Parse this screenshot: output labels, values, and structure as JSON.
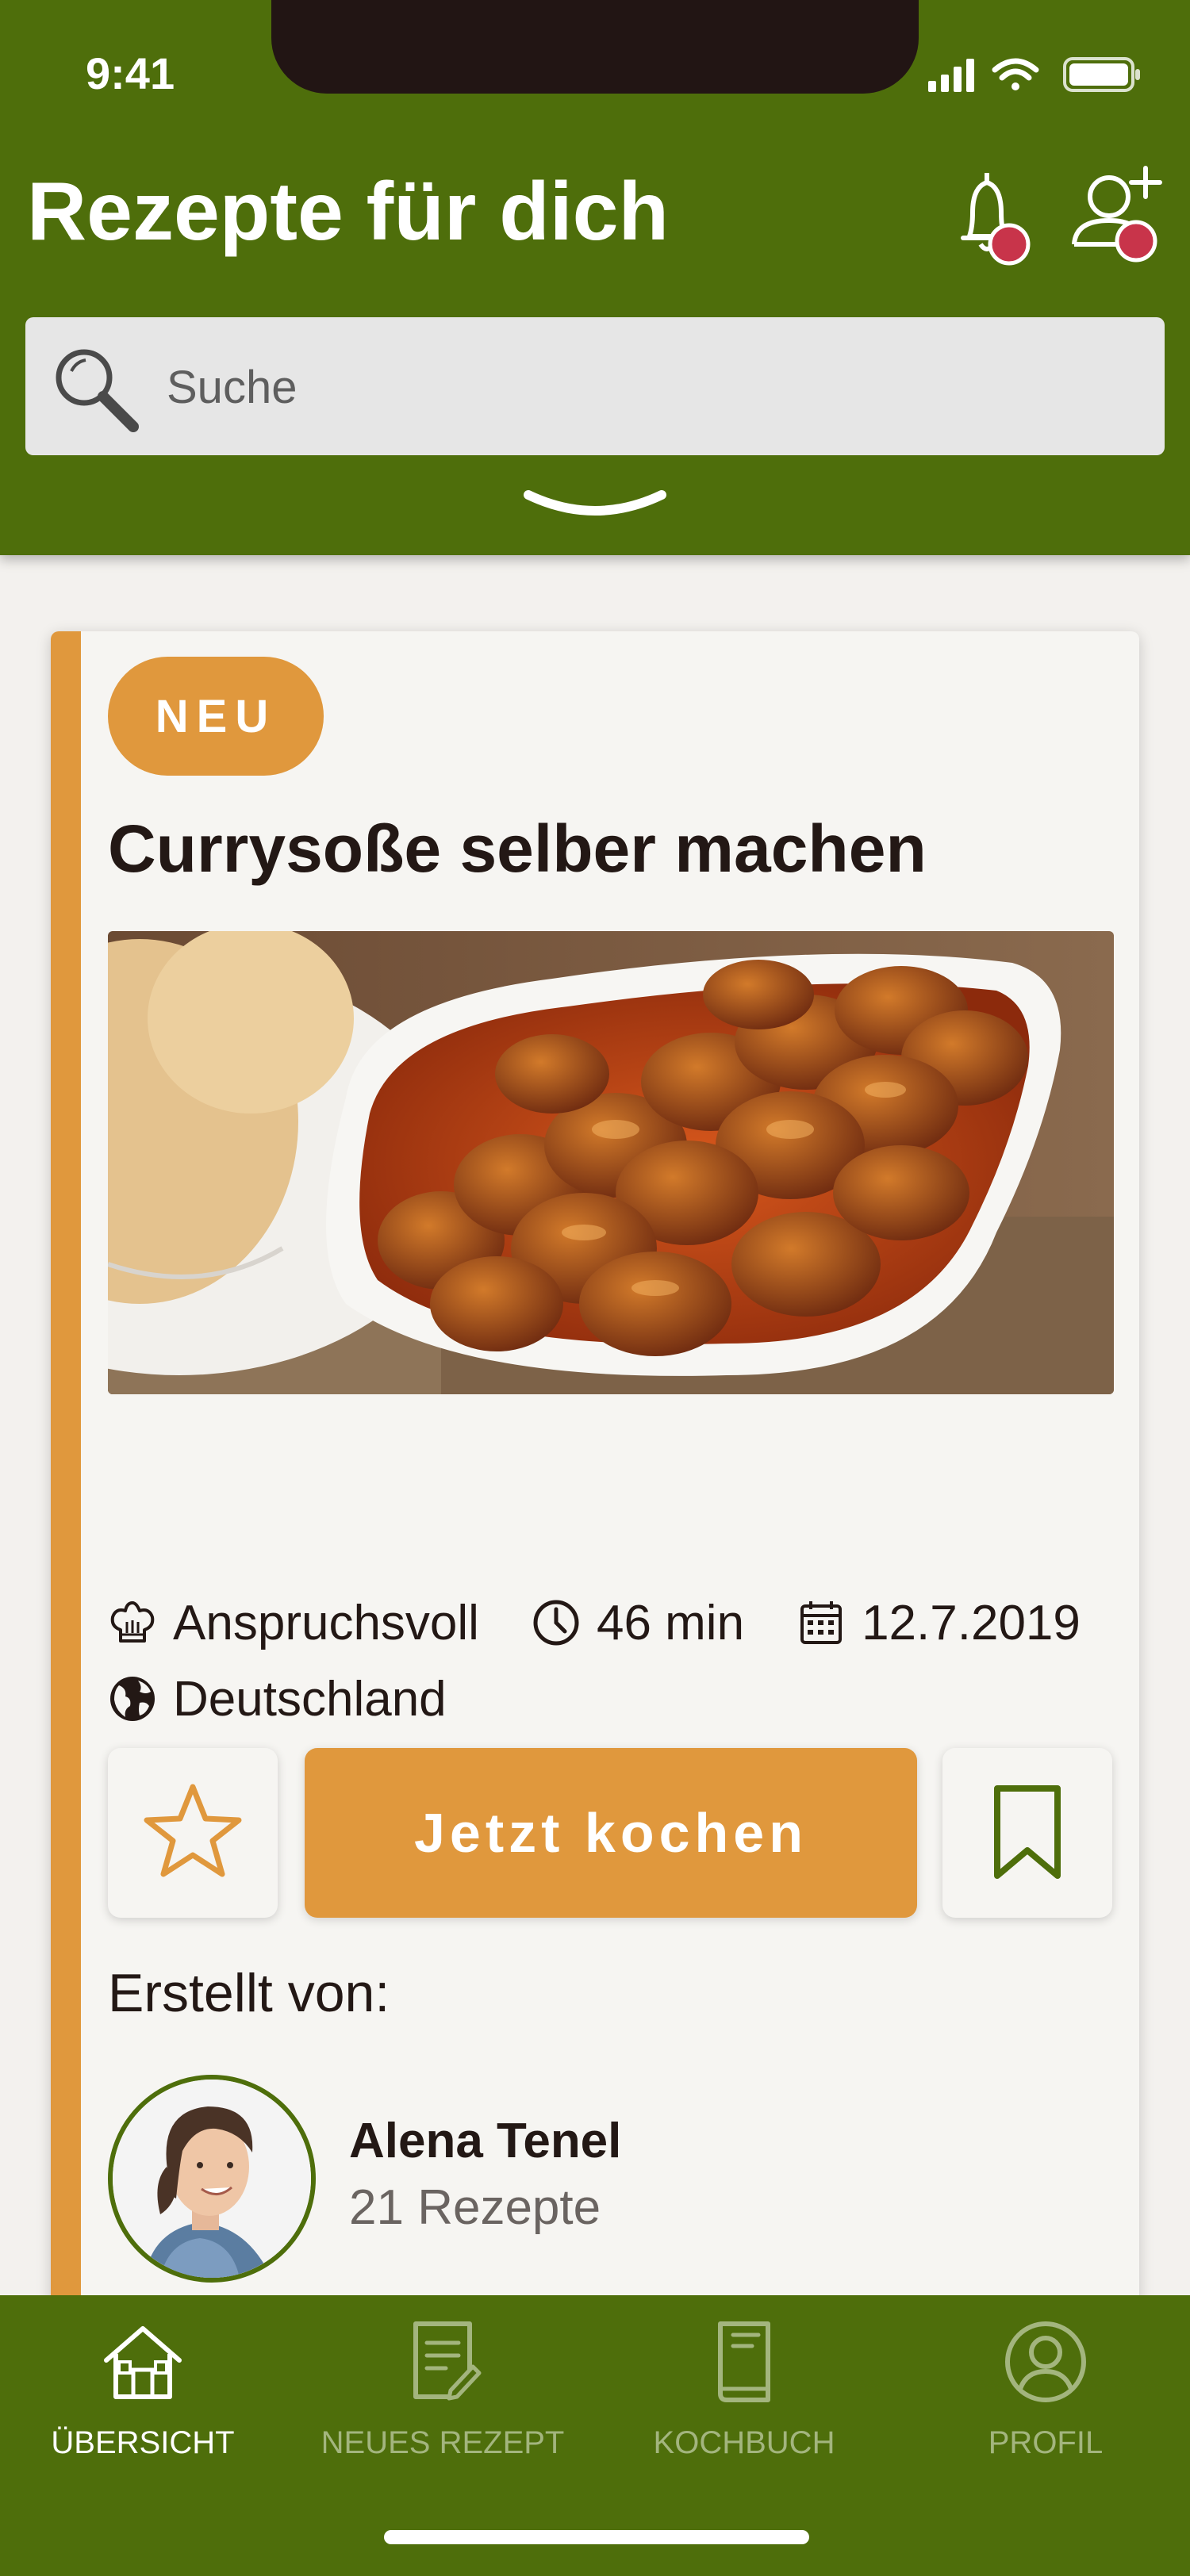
{
  "status_bar": {
    "time": "9:41"
  },
  "header": {
    "title": "Rezepte für dich",
    "search_placeholder": "Suche"
  },
  "recipe": {
    "badge": "NEU",
    "title": "Currysoße selber machen",
    "difficulty": "Anspruchsvoll",
    "duration": "46 min",
    "date": "12.7.2019",
    "country": "Deutschland",
    "cook_button": "Jetzt kochen",
    "creator_label": "Erstellt von:",
    "creator_name": "Alena Tenel",
    "creator_recipes": "21 Rezepte"
  },
  "nav": {
    "items": [
      {
        "label": "ÜBERSICHT",
        "icon": "home-icon",
        "active": true
      },
      {
        "label": "NEUES REZEPT",
        "icon": "new-recipe-icon",
        "active": false
      },
      {
        "label": "KOCHBUCH",
        "icon": "cookbook-icon",
        "active": false
      },
      {
        "label": "PROFIL",
        "icon": "profile-icon",
        "active": false
      }
    ]
  },
  "colors": {
    "primary_green": "#4e6e0b",
    "accent_orange": "#e0983d",
    "notification_red": "#c8344a",
    "background": "#f3f1ee"
  }
}
